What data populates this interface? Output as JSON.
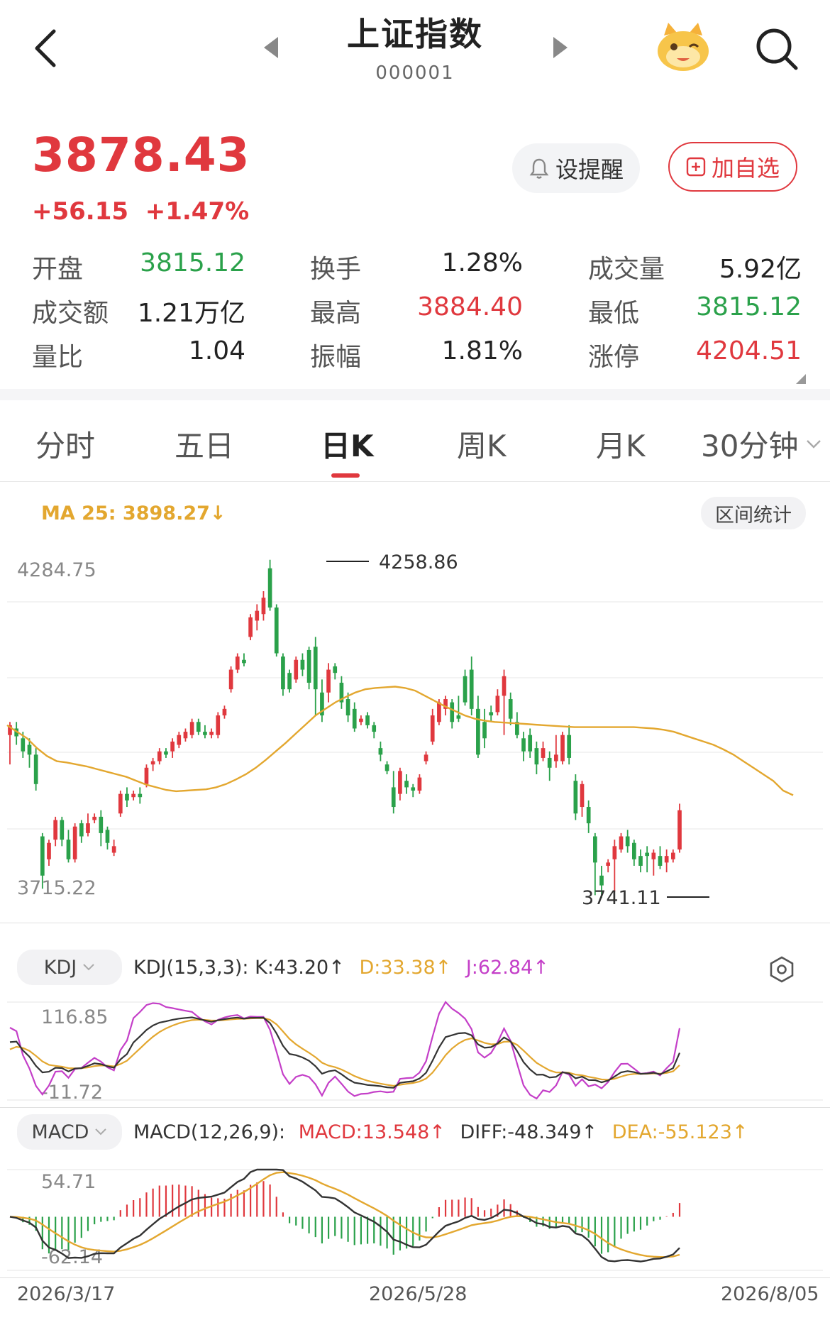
{
  "header": {
    "title": "上证指数",
    "code": "000001"
  },
  "quote": {
    "price": "3878.43",
    "change": "+56.15",
    "change_pct": "+1.47%",
    "alert_label": "设提醒",
    "favorite_label": "加自选"
  },
  "stats": [
    {
      "label": "开盘",
      "value": "3815.12",
      "color": "green"
    },
    {
      "label": "换手",
      "value": "1.28%",
      "color": "dark"
    },
    {
      "label": "成交量",
      "value": "5.92亿",
      "color": "dark"
    },
    {
      "label": "成交额",
      "value": "1.21万亿",
      "color": "dark"
    },
    {
      "label": "最高",
      "value": "3884.40",
      "color": "red"
    },
    {
      "label": "最低",
      "value": "3815.12",
      "color": "green"
    },
    {
      "label": "量比",
      "value": "1.04",
      "color": "dark"
    },
    {
      "label": "振幅",
      "value": "1.81%",
      "color": "dark"
    },
    {
      "label": "涨停",
      "value": "4204.51",
      "color": "red"
    }
  ],
  "tabs": [
    "分时",
    "五日",
    "日K",
    "周K",
    "月K",
    "30分钟"
  ],
  "active_tab": "日K",
  "main_chart": {
    "ma_label": "MA 25: 3898.27↓",
    "range_stats_label": "区间统计",
    "y_top": "4284.75",
    "y_bottom": "3715.22",
    "high_marker": "4258.86",
    "low_marker": "3741.11"
  },
  "kdj": {
    "selector": "KDJ",
    "params": "KDJ(15,3,3):",
    "k": "K:43.20↑",
    "d": "D:33.38↑",
    "j": "J:62.84↑",
    "y_top": "116.85",
    "y_bottom": "-11.72"
  },
  "macd": {
    "selector": "MACD",
    "params": "MACD(12,26,9):",
    "macd": "MACD:13.548↑",
    "diff": "DIFF:-48.349↑",
    "dea": "DEA:-55.123↑",
    "y_top": "54.71",
    "y_bottom": "-62.14"
  },
  "dates": [
    "2026/3/17",
    "2026/5/28",
    "2026/8/05"
  ],
  "colors": {
    "up": "#e0383e",
    "down": "#2aa14a",
    "ma": "#e3a72f",
    "k": "#333333",
    "d": "#e3a72f",
    "j": "#c43fc8"
  },
  "chart_data": {
    "type": "candlestick",
    "y_range": [
      3715.22,
      4284.75
    ],
    "high": 4258.86,
    "low": 3741.11,
    "candles": [
      [
        3990,
        4005,
        3945,
        4010
      ],
      [
        4000,
        3988,
        3975,
        4010
      ],
      [
        3985,
        3965,
        3955,
        3995
      ],
      [
        3975,
        3960,
        3940,
        3985
      ],
      [
        3960,
        3915,
        3905,
        3970
      ],
      [
        3835,
        3775,
        3755,
        3840
      ],
      [
        3800,
        3825,
        3790,
        3830
      ],
      [
        3830,
        3860,
        3820,
        3865
      ],
      [
        3860,
        3830,
        3820,
        3865
      ],
      [
        3830,
        3800,
        3795,
        3845
      ],
      [
        3800,
        3850,
        3795,
        3855
      ],
      [
        3855,
        3835,
        3825,
        3860
      ],
      [
        3840,
        3855,
        3835,
        3870
      ],
      [
        3860,
        3865,
        3855,
        3870
      ],
      [
        3865,
        3840,
        3820,
        3875
      ],
      [
        3845,
        3825,
        3815,
        3850
      ],
      [
        3810,
        3820,
        3805,
        3830
      ],
      [
        3870,
        3900,
        3865,
        3905
      ],
      [
        3900,
        3890,
        3880,
        3910
      ],
      [
        3895,
        3900,
        3890,
        3905
      ],
      [
        3900,
        3895,
        3885,
        3910
      ],
      [
        3915,
        3940,
        3910,
        3945
      ],
      [
        3945,
        3950,
        3935,
        3955
      ],
      [
        3950,
        3965,
        3945,
        3970
      ],
      [
        3965,
        3960,
        3955,
        3970
      ],
      [
        3965,
        3980,
        3955,
        3985
      ],
      [
        3975,
        3990,
        3970,
        3995
      ],
      [
        3985,
        3995,
        3980,
        4000
      ],
      [
        3990,
        4010,
        3985,
        4015
      ],
      [
        4010,
        3995,
        3990,
        4015
      ],
      [
        3995,
        3990,
        3985,
        4005
      ],
      [
        3990,
        3995,
        3985,
        4000
      ],
      [
        3990,
        4020,
        3985,
        4025
      ],
      [
        4020,
        4030,
        4015,
        4035
      ],
      [
        4060,
        4090,
        4055,
        4095
      ],
      [
        4090,
        4110,
        4085,
        4115
      ],
      [
        4105,
        4100,
        4095,
        4115
      ],
      [
        4140,
        4170,
        4135,
        4175
      ],
      [
        4165,
        4180,
        4150,
        4190
      ],
      [
        4175,
        4200,
        4165,
        4210
      ],
      [
        4245,
        4185,
        4180,
        4258
      ],
      [
        4185,
        4115,
        4110,
        4190
      ],
      [
        4110,
        4060,
        4050,
        4115
      ],
      [
        4085,
        4060,
        4055,
        4090
      ],
      [
        4075,
        4105,
        4070,
        4110
      ],
      [
        4105,
        4090,
        4080,
        4115
      ],
      [
        4120,
        4070,
        4060,
        4125
      ],
      [
        4125,
        4060,
        4020,
        4140
      ],
      [
        4055,
        4020,
        4010,
        4075
      ],
      [
        4055,
        4090,
        4040,
        4100
      ],
      [
        4095,
        4085,
        4075,
        4100
      ],
      [
        4070,
        4040,
        4030,
        4080
      ],
      [
        4045,
        4020,
        4010,
        4055
      ],
      [
        4030,
        4000,
        3995,
        4040
      ],
      [
        4010,
        4015,
        4005,
        4020
      ],
      [
        4020,
        4005,
        4000,
        4025
      ],
      [
        4005,
        3995,
        3985,
        4010
      ],
      [
        3970,
        3960,
        3950,
        3980
      ],
      [
        3945,
        3935,
        3930,
        3950
      ],
      [
        3910,
        3880,
        3870,
        3935
      ],
      [
        3900,
        3935,
        3890,
        3940
      ],
      [
        3920,
        3910,
        3900,
        3930
      ],
      [
        3910,
        3905,
        3895,
        3915
      ],
      [
        3905,
        3925,
        3900,
        3930
      ],
      [
        3950,
        3960,
        3945,
        3965
      ],
      [
        3980,
        4020,
        3975,
        4030
      ],
      [
        4010,
        4040,
        4005,
        4045
      ],
      [
        4030,
        4045,
        4020,
        4050
      ],
      [
        4040,
        4010,
        4000,
        4045
      ],
      [
        4020,
        4015,
        4010,
        4050
      ],
      [
        4080,
        4040,
        4035,
        4090
      ],
      [
        4090,
        4030,
        4020,
        4110
      ],
      [
        4030,
        3960,
        3955,
        4050
      ],
      [
        4010,
        3985,
        3970,
        4030
      ],
      [
        4025,
        4020,
        4010,
        4035
      ],
      [
        4025,
        4050,
        4020,
        4060
      ],
      [
        4050,
        4080,
        3990,
        4090
      ],
      [
        4045,
        4015,
        4005,
        4055
      ],
      [
        4010,
        3990,
        3985,
        4025
      ],
      [
        3985,
        3965,
        3950,
        3995
      ],
      [
        3990,
        3965,
        3955,
        4000
      ],
      [
        3970,
        3945,
        3930,
        3980
      ],
      [
        3955,
        3970,
        3950,
        3980
      ],
      [
        3955,
        3940,
        3920,
        3965
      ],
      [
        3950,
        3960,
        3940,
        3990
      ],
      [
        3950,
        3990,
        3945,
        3995
      ],
      [
        3990,
        3955,
        3945,
        4005
      ],
      [
        3920,
        3870,
        3860,
        3930
      ],
      [
        3880,
        3915,
        3865,
        3920
      ],
      [
        3880,
        3855,
        3840,
        3890
      ],
      [
        3835,
        3795,
        3745,
        3840
      ],
      [
        3775,
        3760,
        3741,
        3790
      ],
      [
        3790,
        3795,
        3780,
        3800
      ],
      [
        3800,
        3820,
        3750,
        3830
      ],
      [
        3815,
        3835,
        3810,
        3840
      ],
      [
        3835,
        3820,
        3810,
        3845
      ],
      [
        3825,
        3800,
        3790,
        3830
      ],
      [
        3805,
        3790,
        3780,
        3815
      ],
      [
        3810,
        3805,
        3780,
        3820
      ],
      [
        3800,
        3810,
        3775,
        3815
      ],
      [
        3805,
        3790,
        3785,
        3820
      ],
      [
        3795,
        3805,
        3780,
        3815
      ],
      [
        3800,
        3810,
        3795,
        3815
      ],
      [
        3815,
        3875,
        3810,
        3885
      ]
    ],
    "ma25": [
      4005,
      3995,
      3985,
      3970,
      3958,
      3950,
      3948,
      3945,
      3942,
      3938,
      3934,
      3930,
      3926,
      3920,
      3914,
      3910,
      3906,
      3904,
      3905,
      3906,
      3907,
      3910,
      3915,
      3922,
      3930,
      3940,
      3952,
      3965,
      3978,
      3992,
      4006,
      4020,
      4030,
      4040,
      4048,
      4055,
      4060,
      4062,
      4063,
      4064,
      4062,
      4058,
      4050,
      4042,
      4034,
      4027,
      4020,
      4015,
      4012,
      4010,
      4009,
      4008,
      4007,
      4006,
      4005,
      4004,
      4003,
      4002,
      4002,
      4002,
      4002,
      4002,
      4002,
      4002,
      4001,
      4000,
      3998,
      3995,
      3990,
      3985,
      3980,
      3975,
      3968,
      3960,
      3950,
      3940,
      3930,
      3920,
      3905,
      3898
    ]
  }
}
